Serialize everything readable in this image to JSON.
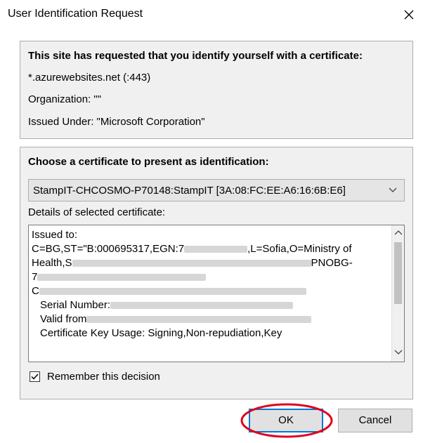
{
  "window": {
    "title": "User Identification Request"
  },
  "site_info": {
    "heading": "This site has requested that you identify yourself with a certificate:",
    "host": "*.azurewebsites.net (:443)",
    "organization": "Organization: \"\"",
    "issued_under": "Issued Under: \"Microsoft Corporation\""
  },
  "certificate": {
    "choose_label": "Choose a certificate to present as identification:",
    "selected": "StampIT-CHCOSMO-P70148:StampIT [3A:08:FC:EE:A6:16:6B:E6]",
    "details_label": "Details of selected certificate:",
    "details": {
      "issued_to": "Issued to:",
      "line1_prefix": "C=BG,ST=\"B:000695317,EGN:7",
      "line1_suffix": ",L=Sofia,O=Ministry of",
      "line2_prefix": "Health,S",
      "line2_suffix": "PNOBG-",
      "line3_prefix": "7",
      "line4_prefix": "C",
      "line5_prefix": "Serial Number:",
      "line6_prefix": "Valid from",
      "line7": "Certificate Key Usage: Signing,Non-repudiation,Key"
    }
  },
  "remember": {
    "label": "Remember this decision",
    "checked": true
  },
  "buttons": {
    "ok": "OK",
    "cancel": "Cancel"
  },
  "colors": {
    "panel_bg": "#f0f0f0",
    "focus_border": "#0078d7",
    "annotation_red": "#e0001b"
  }
}
